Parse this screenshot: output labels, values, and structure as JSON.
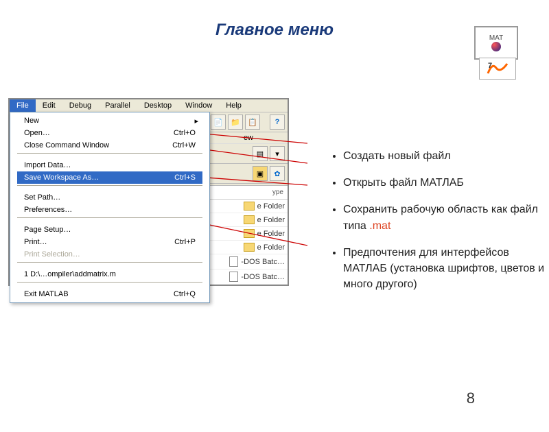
{
  "title": "Главное меню",
  "logo_text": "MAT",
  "menubar": [
    "File",
    "Edit",
    "Debug",
    "Parallel",
    "Desktop",
    "Window",
    "Help"
  ],
  "menu": {
    "new": "New",
    "open": "Open…",
    "open_key": "Ctrl+O",
    "close_cw": "Close Command Window",
    "close_cw_key": "Ctrl+W",
    "import": "Import Data…",
    "save_ws": "Save Workspace As…",
    "save_ws_key": "Ctrl+S",
    "set_path": "Set Path…",
    "prefs": "Preferences…",
    "page_setup": "Page Setup…",
    "print": "Print…",
    "print_key": "Ctrl+P",
    "print_sel": "Print Selection…",
    "recent": "1 D:\\…ompiler\\addmatrix.m",
    "exit": "Exit MATLAB",
    "exit_key": "Ctrl+Q"
  },
  "second_tab": "ew",
  "col_type": "ype",
  "rows": {
    "f1": "e Folder",
    "f2": "e Folder",
    "f3": "e Folder",
    "f4": "e Folder",
    "b1": "-DOS Batc…",
    "b2": "-DOS Batc…"
  },
  "bullets": {
    "b1": "Создать новый файл",
    "b2": "Открыть файл МАТЛАБ",
    "b3a": "Сохранить рабочую область как файл типа ",
    "b3b": ".mat",
    "b4": "Предпочтения для интерфейсов МАТЛАБ (установка шрифтов, цветов и много другого)"
  },
  "page_number": "8"
}
